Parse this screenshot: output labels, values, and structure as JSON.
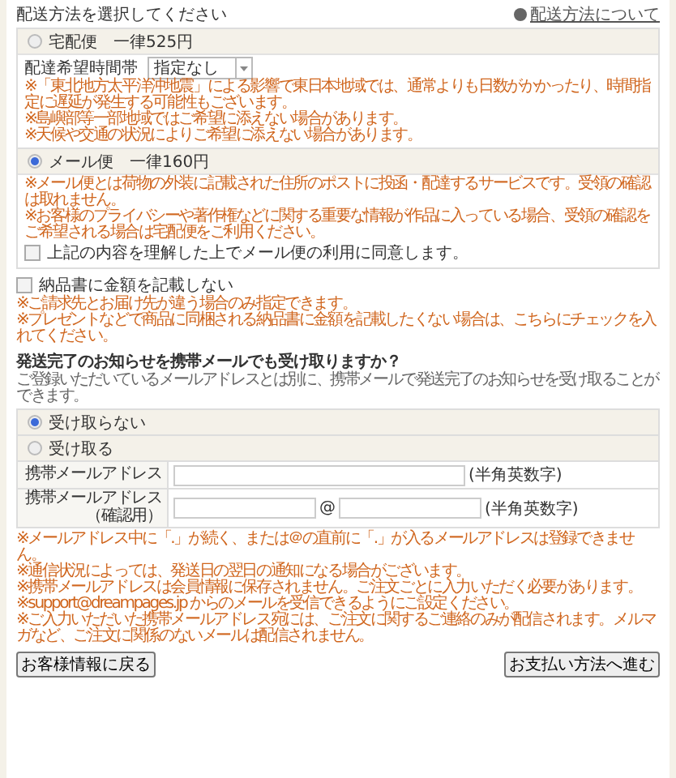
{
  "header": {
    "title": "配送方法を選択してください",
    "help_link": "配送方法について"
  },
  "shipping_options": [
    {
      "label": "宅配便",
      "price": "一律525円",
      "selected": false,
      "time_label": "配達希望時間帯",
      "time_value": "指定なし",
      "notes": [
        "※「東北地方太平洋沖地震」による影響で東日本地域では、通常よりも日数がかかったり、時間指定に遅延が発生する可能性もございます。",
        "※島嶼部等一部地域ではご希望に添えない場合があります。",
        "※天候や交通の状況によりご希望に添えない場合があります。"
      ]
    },
    {
      "label": "メール便",
      "price": "一律160円",
      "selected": true,
      "notes": [
        "※メール便とは荷物の外装に記載された住所のポストに投函・配達するサービスです。受領の確認は取れません。",
        "※お客様のプライバシーや著作権などに関する重要な情報が作品に入っている場合、受領の確認をご希望される場合は宅配便をご利用ください。"
      ],
      "agreement": {
        "label": "上記の内容を理解した上でメール便の利用に同意します。",
        "checked": false
      }
    }
  ],
  "invoice": {
    "label": "納品書に金額を記載しない",
    "checked": false,
    "notes": [
      "※ご請求先とお届け先が違う場合のみ指定できます。",
      "※プレゼントなどで商品に同梱される納品書に金額を記載したくない場合は、こちらにチェックを入れてください。"
    ]
  },
  "mobile_notice": {
    "heading": "発送完了のお知らせを携帯メールでも受け取りますか？",
    "description": "ご登録いただいているメールアドレスとは別に、携帯メールで発送完了のお知らせを受け取ることができます。",
    "options": [
      {
        "label": "受け取らない",
        "selected": true
      },
      {
        "label": "受け取る",
        "selected": false
      }
    ],
    "fields": [
      {
        "kind": "single",
        "label": "携帯メールアドレス",
        "hint": "(半角英数字)"
      },
      {
        "kind": "split",
        "label": "携帯メールアドレス",
        "sublabel": "（確認用）",
        "separator": "@",
        "hint": "(半角英数字)"
      }
    ],
    "notes": [
      "※メールアドレス中に「.」が続く、または＠の直前に「.」が入るメールアドレスは登録できません。",
      "※通信状況によっては、発送日の翌日の通知になる場合がございます。",
      "※携帯メールアドレスは会員情報に保存されません。ご注文ごとに入力いただく必要があります。",
      "※support@dreampages.jp からのメールを受信できるようにご設定ください。",
      "※ご入力いただいた携帯メールアドレス宛には、ご注文に関するご連絡のみが配信されます。メルマガなど、ご注文に関係のないメールは配信されません。"
    ]
  },
  "buttons": {
    "back": "お客様情報に戻る",
    "next": "お支払い方法へ進む"
  }
}
